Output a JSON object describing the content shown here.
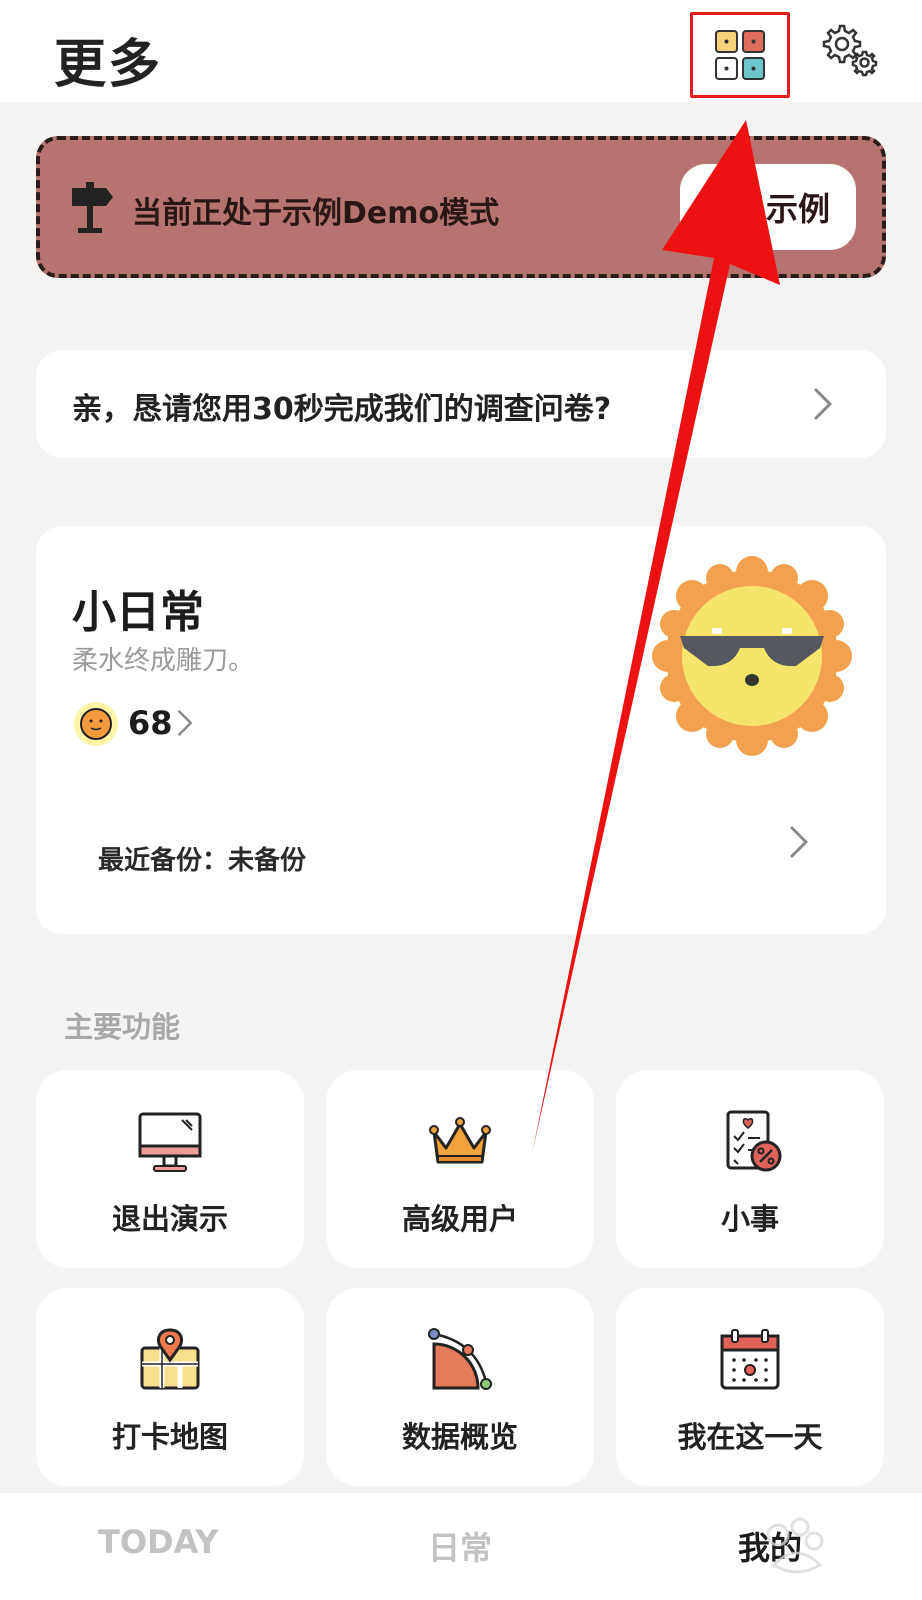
{
  "header": {
    "title": "更多",
    "grid_icon": "grid-icon",
    "settings_icon": "gear-icon"
  },
  "demo_banner": {
    "text": "当前正处于示例Demo模式",
    "button_label": "出示例",
    "icon": "signpost-icon"
  },
  "survey": {
    "text": "亲，恳请您用30秒完成我们的调查问卷?"
  },
  "profile": {
    "name": "小日常",
    "motto": "柔水终成雕刀。",
    "sun_count": "68",
    "backup_label": "最近备份：未备份"
  },
  "features": {
    "section_title": "主要功能",
    "items": [
      {
        "label": "退出演示",
        "icon": "monitor-icon"
      },
      {
        "label": "高级用户",
        "icon": "crown-icon"
      },
      {
        "label": "小事",
        "icon": "checklist-icon"
      },
      {
        "label": "打卡地图",
        "icon": "map-pin-icon"
      },
      {
        "label": "数据概览",
        "icon": "chart-curve-icon"
      },
      {
        "label": "我在这一天",
        "icon": "calendar-icon"
      }
    ]
  },
  "tabbar": {
    "tabs": [
      {
        "label": "TODAY",
        "active": false
      },
      {
        "label": "日常",
        "active": false
      },
      {
        "label": "我的",
        "active": true
      }
    ]
  },
  "colors": {
    "banner_bg": "#b67470",
    "highlight_box": "#e31d1d",
    "arrow": "#ee1111",
    "page_bg": "#f5f4f2"
  }
}
